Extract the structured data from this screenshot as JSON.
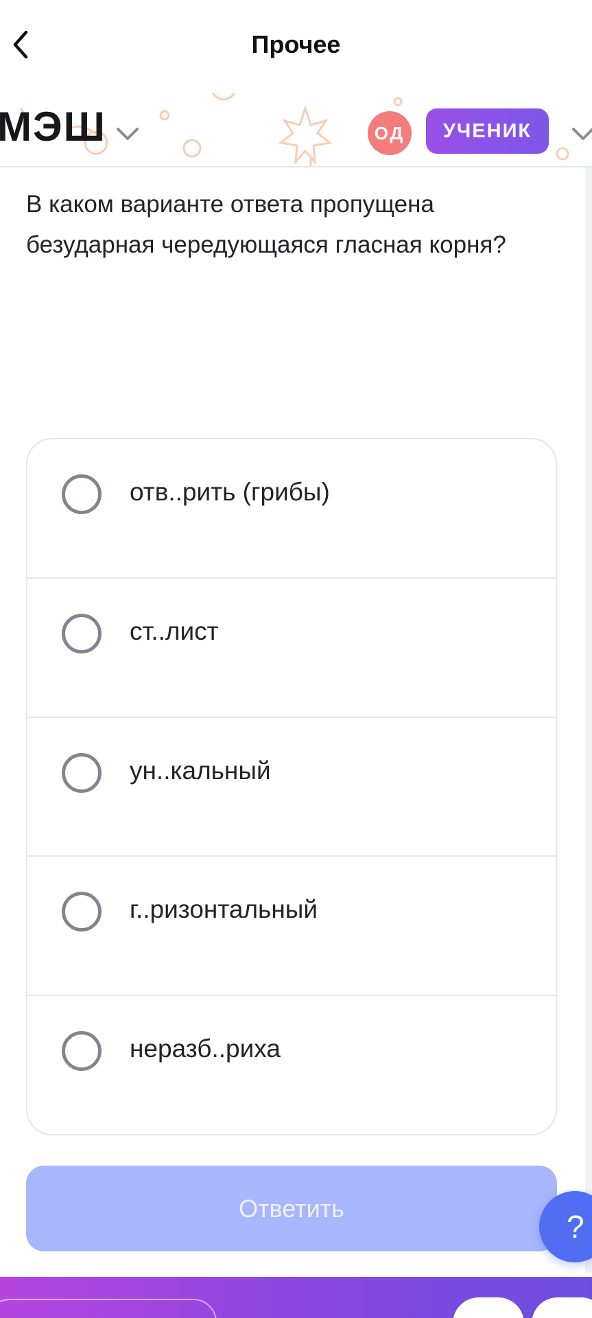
{
  "nav": {
    "title": "Прочее",
    "back_icon": "chevron-left-icon"
  },
  "header": {
    "logo": "МЭШ",
    "avatar_initials": "ОД",
    "role_label": "УЧЕНИК",
    "avatar_color": "#f47c7c",
    "role_color": "#8a52e6"
  },
  "question": {
    "text": "В каком варианте ответа пропущена безударная чередующаяся гласная корня?",
    "options": [
      {
        "label": "отв..рить (грибы)"
      },
      {
        "label": "ст..лист"
      },
      {
        "label": "ун..кальный"
      },
      {
        "label": "г..ризонтальный"
      },
      {
        "label": "неразб..риха"
      }
    ]
  },
  "actions": {
    "submit_label": "Ответить",
    "submit_color": "#a8b6fb",
    "help_label": "?"
  }
}
